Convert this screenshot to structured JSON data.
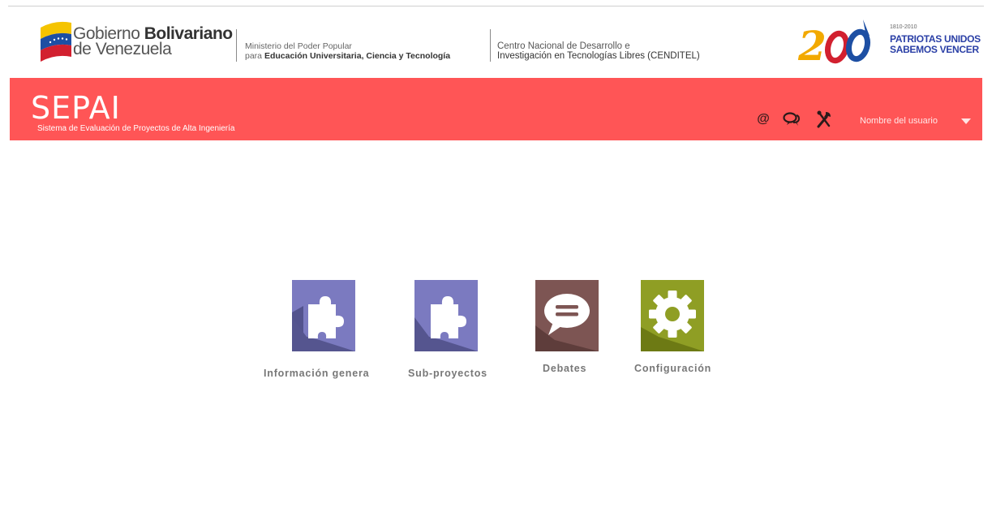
{
  "gov": {
    "gob_word1": "Gobierno ",
    "gob_word2": "Bolivariano",
    "gob_line2": "de Venezuela",
    "ministry_line1": "Ministerio del Poder Popular",
    "ministry_prefix": "para ",
    "ministry_line2": "Educación Universitaria, Ciencia y Tecnología",
    "cenditel_line1": "Centro Nacional de Desarrollo e",
    "cenditel_line2": "Investigación en Tecnologías Libres (CENDITEL)",
    "bicentennial_years": "1810-2010",
    "bicentennial_line1": "PATRIOTAS UNIDOS",
    "bicentennial_line2": "SABEMOS VENCER"
  },
  "app": {
    "title": "SEPAI",
    "subtitle": "Sistema de Evaluación de Proyectos de Alta Ingeniería",
    "user_name": "Nombre del usuario",
    "accent": "#ff5556"
  },
  "tiles": [
    {
      "label": "Información genera",
      "icon": "puzzle-icon",
      "color": "#7b7ac0"
    },
    {
      "label": "Sub-proyectos",
      "icon": "puzzle-icon",
      "color": "#7b7ac0"
    },
    {
      "label": "Debates",
      "icon": "chat-bubble-icon",
      "color": "#7d5553"
    },
    {
      "label": "Configuración",
      "icon": "gear-icon",
      "color": "#8f9e24"
    }
  ]
}
